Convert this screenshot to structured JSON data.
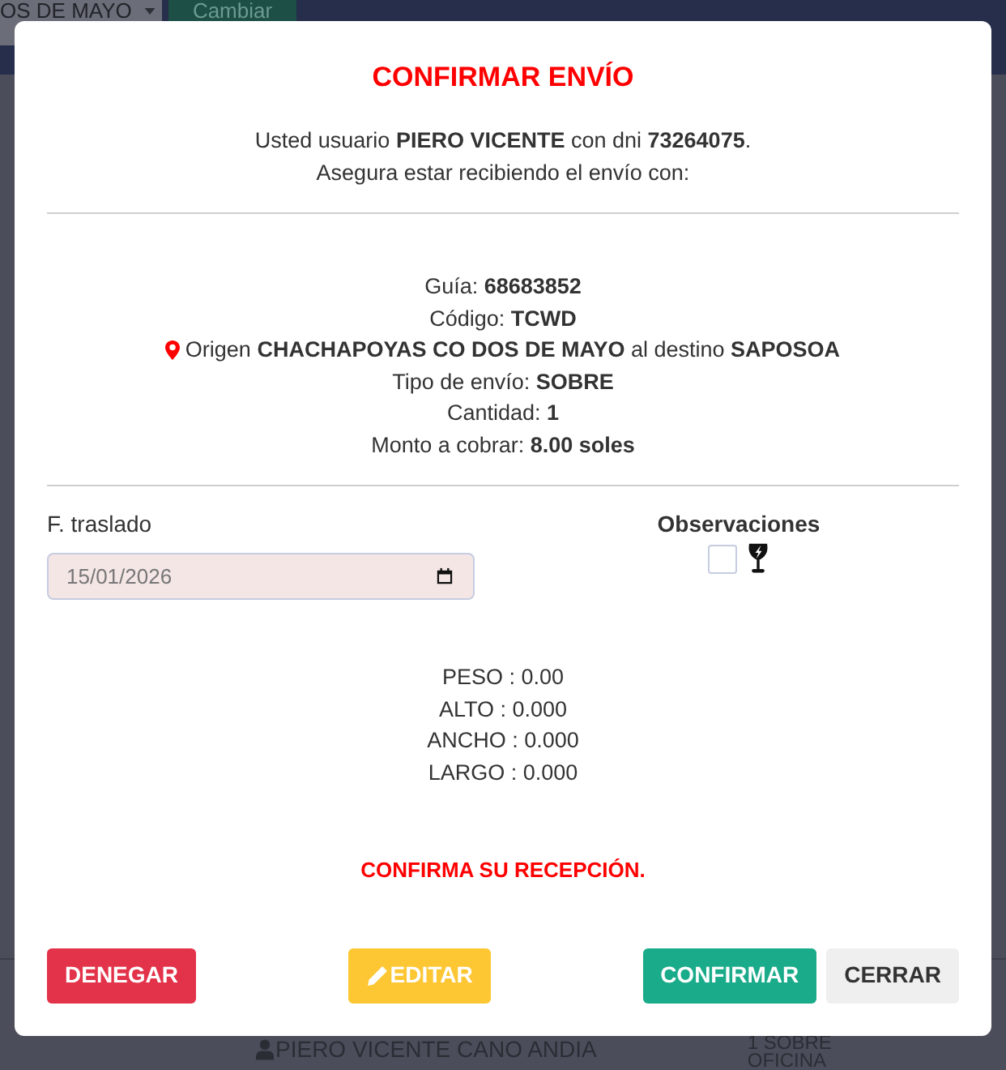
{
  "background": {
    "branch_select": "OS DE MAYO",
    "change_button": "Cambiar",
    "row": {
      "user": "PIERO VICENTE CANO ANDIA",
      "shipment": [
        "1 SOBRE",
        "OFICINA"
      ]
    }
  },
  "modal": {
    "title": "CONFIRMAR ENVÍO",
    "intro": [
      "Usted usuario **PIERO VICENTE** con dni **73264075**.",
      "Asegura estar recibiendo el envío con:"
    ],
    "details": [
      {
        "kind": "plain",
        "text": "Guía: **68683852**"
      },
      {
        "kind": "plain",
        "text": "Código: **TCWD**"
      },
      {
        "kind": "route",
        "text": "Origen **CHACHAPOYAS CO DOS DE MAYO** al destino **SAPOSOA**"
      },
      {
        "kind": "plain",
        "text": "Tipo de envío: **SOBRE**"
      },
      {
        "kind": "plain",
        "text": "Cantidad: **1**"
      },
      {
        "kind": "plain",
        "text": "Monto a cobrar: **8.00 soles**"
      }
    ],
    "transfer_date": {
      "label": "F. traslado",
      "value": "15/01/2026"
    },
    "observations": {
      "label": "Observaciones",
      "options": [
        {
          "kind": "fragile",
          "checked": false
        }
      ]
    },
    "measurements": [
      "PESO : 0.00",
      "ALTO : 0.000",
      "ANCHO : 0.000",
      "LARGO : 0.000"
    ],
    "notice": "CONFIRMA SU RECEPCIÓN.",
    "buttons": [
      {
        "kind": "deny",
        "label": "DENEGAR"
      },
      {
        "kind": "edit",
        "label": "EDITAR"
      },
      {
        "kind": "confirm",
        "label": "CONFIRMAR"
      },
      {
        "kind": "close",
        "label": "CERRAR"
      }
    ]
  }
}
